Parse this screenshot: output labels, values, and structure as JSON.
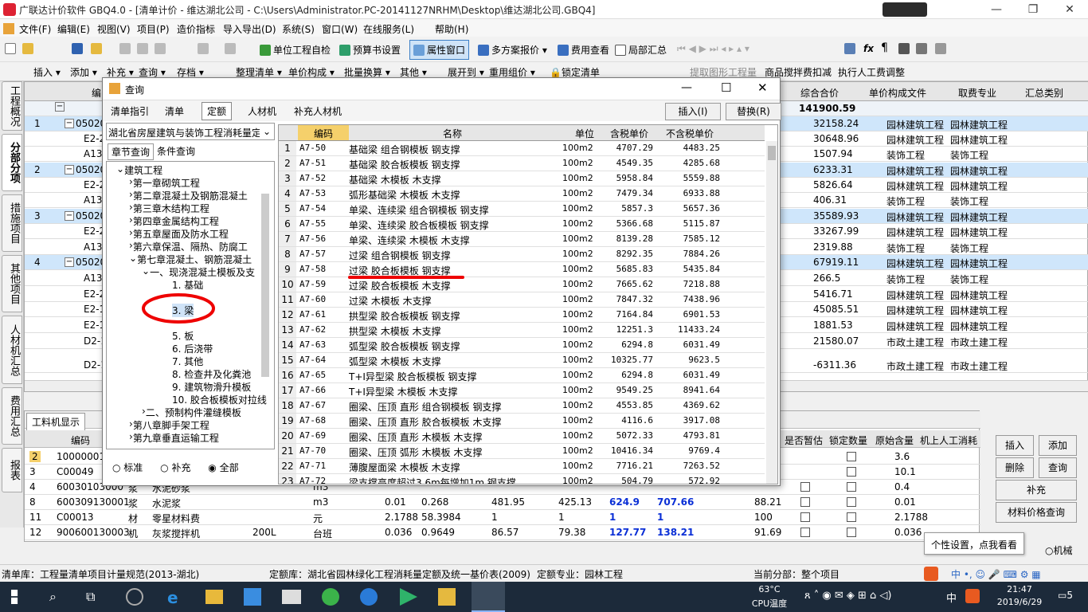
{
  "title": "广联达计价软件 GBQ4.0 - [清单计价 - 维达湖北公司 - C:\\Users\\Administrator.PC-20141127NRHM\\Desktop\\维达湖北公司.GBQ4]",
  "menu": [
    "文件(F)",
    "编辑(E)",
    "视图(V)",
    "项目(P)",
    "造价指标",
    "导入导出(D)",
    "系统(S)",
    "窗口(W)",
    "在线服务(L)",
    "帮助(H)"
  ],
  "toolbar1": [
    "单位工程自检",
    "预算书设置",
    "属性窗口",
    "多方案报价",
    "费用查看",
    "局部汇总"
  ],
  "toolbar2": [
    "插入",
    "添加",
    "补充",
    "查询",
    "存档",
    "整理清单",
    "单价构成",
    "批量换算",
    "其他",
    "展开到",
    "重用组价",
    "锁定清单",
    "提取图形工程量",
    "商品搅拌费扣减",
    "执行人工费调整"
  ],
  "left_tabs": [
    "工程概况",
    "分部分项",
    "措施项目",
    "其他项目",
    "人材机汇总",
    "费用汇总",
    "报表"
  ],
  "grid": {
    "headers": [
      "编",
      "综合合价",
      "单价构成文件",
      "取费专业",
      "汇总类别"
    ],
    "total": "141900.59",
    "rows": [
      {
        "no": "1",
        "code": "050201",
        "sum": "32158.24",
        "f1": "园林建筑工程",
        "f2": "园林建筑工程",
        "blue": true
      },
      {
        "no": "",
        "code": "E2-2",
        "sum": "30648.96",
        "f1": "园林建筑工程",
        "f2": "园林建筑工程",
        "blue": false
      },
      {
        "no": "",
        "code": "A13-",
        "sum": "1507.94",
        "f1": "装饰工程",
        "f2": "装饰工程",
        "blue": false
      },
      {
        "no": "2",
        "code": "050201",
        "sum": "6233.31",
        "f1": "园林建筑工程",
        "f2": "园林建筑工程",
        "blue": true
      },
      {
        "no": "",
        "code": "E2-2",
        "sum": "5826.64",
        "f1": "园林建筑工程",
        "f2": "园林建筑工程",
        "blue": false
      },
      {
        "no": "",
        "code": "A13-",
        "sum": "406.31",
        "f1": "装饰工程",
        "f2": "装饰工程",
        "blue": false
      },
      {
        "no": "3",
        "code": "050201",
        "sum": "35589.93",
        "f1": "园林建筑工程",
        "f2": "园林建筑工程",
        "blue": true
      },
      {
        "no": "",
        "code": "E2-2",
        "sum": "33267.99",
        "f1": "园林建筑工程",
        "f2": "园林建筑工程",
        "blue": false
      },
      {
        "no": "",
        "code": "A13-",
        "sum": "2319.88",
        "f1": "装饰工程",
        "f2": "装饰工程",
        "blue": false
      },
      {
        "no": "4",
        "code": "050201",
        "sum": "67919.11",
        "f1": "园林建筑工程",
        "f2": "园林建筑工程",
        "blue": true
      },
      {
        "no": "",
        "code": "A13-",
        "sum": "266.5",
        "f1": "装饰工程",
        "f2": "装饰工程",
        "blue": false
      },
      {
        "no": "",
        "code": "E2-2",
        "sum": "5416.71",
        "f1": "园林建筑工程",
        "f2": "园林建筑工程",
        "blue": false
      },
      {
        "no": "",
        "code": "E2-1",
        "sum": "45085.51",
        "f1": "园林建筑工程",
        "f2": "园林建筑工程",
        "blue": false
      },
      {
        "no": "",
        "code": "E2-1",
        "sum": "1881.53",
        "f1": "园林建筑工程",
        "f2": "园林建筑工程",
        "blue": false
      },
      {
        "no": "",
        "code": "D2-1",
        "sum": "21580.07",
        "f1": "市政土建工程",
        "f2": "市政土建工程",
        "blue": false
      },
      {
        "no": "",
        "code": "D2-1",
        "sum": "-6311.36",
        "f1": "市政土建工程",
        "f2": "市政土建工程",
        "blue": false
      }
    ]
  },
  "bottom": {
    "tab": "工料机显示",
    "headers": [
      "编码",
      "是否暂估",
      "锁定数量",
      "原始含量",
      "机上人工消耗"
    ],
    "rows": [
      {
        "no": "2",
        "code": "100000010",
        "c1": "",
        "c2": "",
        "unit": "",
        "a": "",
        "b": "",
        "p1": "",
        "p2": "",
        "p3": "",
        "p4": "",
        "p5": "",
        "orig": "3.6"
      },
      {
        "no": "3",
        "code": "C00049",
        "c1": "",
        "c2": "",
        "unit": "",
        "a": "",
        "b": "",
        "p1": "",
        "p2": "",
        "p3": "",
        "p4": "",
        "p5": "",
        "orig": "10.1"
      },
      {
        "no": "4",
        "code": "60030103000",
        "c1": "浆",
        "c2": "水泥砂浆",
        "unit": "m3",
        "a": "",
        "b": "",
        "p1": "",
        "p2": "",
        "p3": "",
        "p4": "",
        "p5": "",
        "orig": "0.4"
      },
      {
        "no": "8",
        "code": "600309130001",
        "c1": "浆",
        "c2": "水泥浆",
        "unit": "m3",
        "a": "0.01",
        "b": "0.268",
        "p1": "481.95",
        "p2": "425.13",
        "p3": "624.9",
        "p4": "707.66",
        "p5": "88.21",
        "orig": "0.01"
      },
      {
        "no": "11",
        "code": "C00013",
        "c1": "材",
        "c2": "零星材料费",
        "unit": "元",
        "a": "2.1788",
        "b": "58.3984",
        "p1": "1",
        "p2": "1",
        "p3": "1",
        "p4": "1",
        "p5": "100",
        "orig": "2.1788"
      },
      {
        "no": "12",
        "code": "900600130003",
        "c1": "机",
        "c2": "灰浆搅拌机",
        "unit": "台班",
        "a": "0.036",
        "b": "0.9649",
        "p1": "86.57",
        "p2": "79.38",
        "p3": "127.77",
        "p4": "138.21",
        "p5": "91.69",
        "orig": "0.036"
      }
    ],
    "extra": "200L",
    "buttons": [
      "插入",
      "添加",
      "删除",
      "查询",
      "补充",
      "材料价格查询"
    ]
  },
  "status": {
    "a": "清单库：工程量清单项目计量规范(2013-湖北)",
    "b": "定额库：湖北省园林绿化工程消耗量定额及统一基价表(2009)",
    "c": "定额专业：园林工程",
    "d": "当前分部：整个项目"
  },
  "tooltip": "个性设置，点我看看",
  "radio_machine": "机械",
  "taskbar": {
    "temp": "63°C",
    "temp_label": "CPU温度",
    "time": "21:47",
    "date": "2019/6/29",
    "ime": "中",
    "badge": "5"
  },
  "dialog": {
    "title": "查询",
    "tabs": [
      "清单指引",
      "清单",
      "定额",
      "人材机",
      "补充人材机"
    ],
    "btn_insert": "插入(I)",
    "btn_replace": "替换(R)",
    "library": "湖北省房屋建筑与装饰工程消耗量定",
    "subtabs": [
      "章节查询",
      "条件查询"
    ],
    "tree": [
      "建筑工程",
      "第一章砌筑工程",
      "第二章混凝土及钢筋混凝土",
      "第三章木结构工程",
      "第四章金属结构工程",
      "第五章屋面及防水工程",
      "第六章保温、隔热、防腐工",
      "第七章混凝土、钢筋混凝土",
      "一、现浇混凝土模板及支",
      "1. 基础",
      "3. 梁",
      "5. 板",
      "6. 后浇带",
      "7. 其他",
      "8. 检查井及化粪池",
      "9. 建筑物滑升模板",
      "10. 胶合板模板对拉线",
      "二、预制构件灌缝模板",
      "第八章脚手架工程",
      "第九章垂直运输工程"
    ],
    "radios": [
      "标准",
      "补充",
      "全部"
    ],
    "table_headers": [
      "编码",
      "名称",
      "单位",
      "含税单价",
      "不含税单价"
    ],
    "rows": [
      [
        "1",
        "A7-50",
        "基础梁 组合钢模板 钢支撑",
        "100m2",
        "4707.29",
        "4483.25"
      ],
      [
        "2",
        "A7-51",
        "基础梁 胶合板模板 钢支撑",
        "100m2",
        "4549.35",
        "4285.68"
      ],
      [
        "3",
        "A7-52",
        "基础梁 木模板 木支撑",
        "100m2",
        "5958.84",
        "5559.88"
      ],
      [
        "4",
        "A7-53",
        "弧形基础梁 木模板 木支撑",
        "100m2",
        "7479.34",
        "6933.88"
      ],
      [
        "5",
        "A7-54",
        "单梁、连续梁 组合钢模板 钢支撑",
        "100m2",
        "5857.3",
        "5657.36"
      ],
      [
        "6",
        "A7-55",
        "单梁、连续梁 胶合板模板 钢支撑",
        "100m2",
        "5366.68",
        "5115.87"
      ],
      [
        "7",
        "A7-56",
        "单梁、连续梁 木模板 木支撑",
        "100m2",
        "8139.28",
        "7585.12"
      ],
      [
        "8",
        "A7-57",
        "过梁 组合钢模板 钢支撑",
        "100m2",
        "8292.35",
        "7884.26"
      ],
      [
        "9",
        "A7-58",
        "过梁 胶合板模板 钢支撑",
        "100m2",
        "5685.83",
        "5435.84"
      ],
      [
        "10",
        "A7-59",
        "过梁 胶合板模板 木支撑",
        "100m2",
        "7665.62",
        "7218.88"
      ],
      [
        "11",
        "A7-60",
        "过梁 木模板 木支撑",
        "100m2",
        "7847.32",
        "7438.96"
      ],
      [
        "12",
        "A7-61",
        "拱型梁 胶合板模板 钢支撑",
        "100m2",
        "7164.84",
        "6901.53"
      ],
      [
        "13",
        "A7-62",
        "拱型梁 木模板 木支撑",
        "100m2",
        "12251.3",
        "11433.24"
      ],
      [
        "14",
        "A7-63",
        "弧型梁 胶合板模板 钢支撑",
        "100m2",
        "6294.8",
        "6031.49"
      ],
      [
        "15",
        "A7-64",
        "弧型梁 木模板 木支撑",
        "100m2",
        "10325.77",
        "9623.5"
      ],
      [
        "16",
        "A7-65",
        "T+I异型梁 胶合板模板 钢支撑",
        "100m2",
        "6294.8",
        "6031.49"
      ],
      [
        "17",
        "A7-66",
        "T+I异型梁 木模板 木支撑",
        "100m2",
        "9549.25",
        "8941.64"
      ],
      [
        "18",
        "A7-67",
        "圈梁、压顶 直形 组合钢模板 钢支撑",
        "100m2",
        "4553.85",
        "4369.62"
      ],
      [
        "19",
        "A7-68",
        "圈梁、压顶 直形 胶合板模板 木支撑",
        "100m2",
        "4116.6",
        "3917.08"
      ],
      [
        "20",
        "A7-69",
        "圈梁、压顶 直形 木模板 木支撑",
        "100m2",
        "5072.33",
        "4793.81"
      ],
      [
        "21",
        "A7-70",
        "圈梁、压顶 弧形 木模板 木支撑",
        "100m2",
        "10416.34",
        "9769.4"
      ],
      [
        "22",
        "A7-71",
        "薄腹屋面梁 木模板 木支撑",
        "100m2",
        "7716.21",
        "7263.52"
      ],
      [
        "23",
        "A7-72",
        "梁支撑高度超过3.6m每增加1m 钢支撑",
        "100m2",
        "504.79",
        "572.92"
      ]
    ]
  }
}
